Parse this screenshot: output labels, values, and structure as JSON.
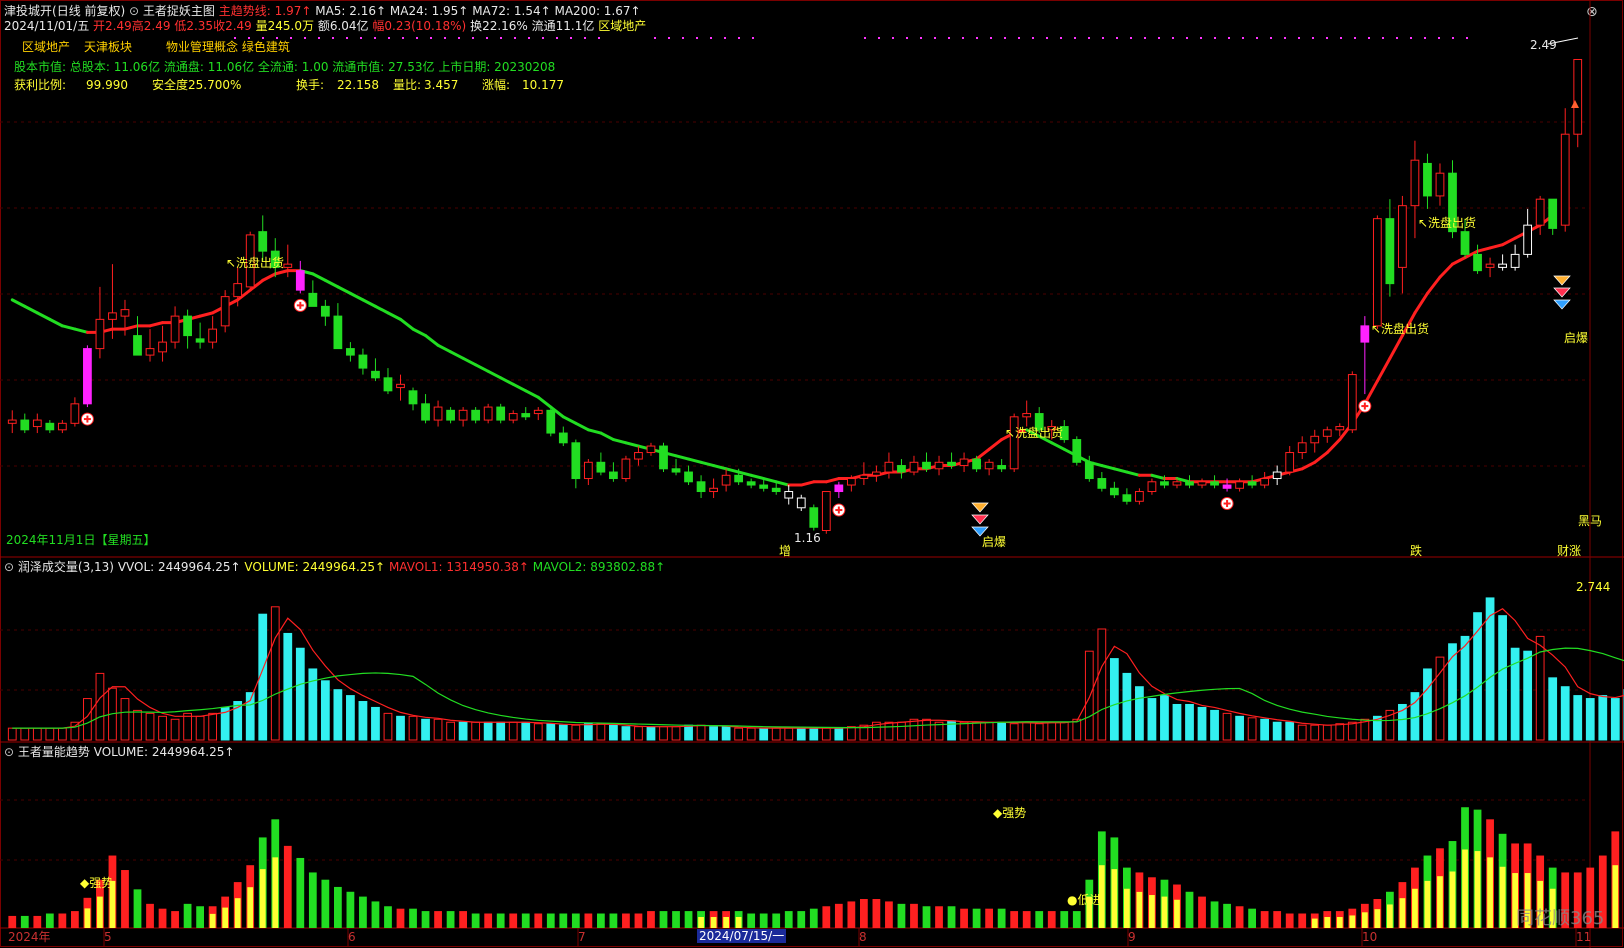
{
  "header": {
    "stock_name": "津投城开",
    "mode": "(日线 前复权)",
    "indicator_toggle": "⊙",
    "indicator_name": "王者捉妖主图",
    "main_trend_label": "主趋势线: 1.97↑",
    "ma5": "MA5: 2.16↑",
    "ma24": "MA24: 1.95↑",
    "ma72": "MA72: 1.54↑",
    "ma200": "MA200: 1.67↑",
    "close_button": "⊗",
    "quote_date": "2024/11/01/五",
    "open": "开2.49",
    "high": "高2.49",
    "low": "低2.35",
    "close": "收2.49",
    "volume": "量245.0万",
    "amount": "额6.04亿",
    "change": "幅0.23(10.18%)",
    "turnover": "换22.16%",
    "float": "流通11.1亿",
    "sector": "区域地产"
  },
  "info": {
    "sector1": "区域地产",
    "sector2": "天津板块",
    "concepts": "物业管理概念 绿色建筑",
    "shares_line": "股本市值: 总股本: 11.06亿 流通盘: 11.06亿 全流通: 1.00 流通市值: 27.53亿 上市日期: 20230208",
    "profit_label": "获利比例:",
    "profit_value": "99.990",
    "safety_label": "安全度25.700%",
    "turnover_label": "换手:",
    "turnover_value": "22.158",
    "vol_ratio_label": "量比:",
    "vol_ratio_value": "3.457",
    "amp_label": "涨幅:",
    "amp_value": "10.177"
  },
  "price_labels": {
    "high_mark": "2.49",
    "low_mark": "1.16",
    "bottom_date": "2024年11月1日【星期五】",
    "black_horse": "黑马"
  },
  "annotations": {
    "wash1": "↖洗盘出货",
    "wash2": "↖洗盘出货",
    "wash3": "↖洗盘出货",
    "wash4": "↖洗盘出货",
    "qibao1": "启爆",
    "qibao2": "启爆",
    "tag_zeng": "增",
    "tag_die": "跌",
    "tag_caizhang": "财涨"
  },
  "volume_pane": {
    "title": "润泽成交量(3,13)",
    "vvol": "VVOL: 2449964.25↑",
    "volume": "VOLUME: 2449964.25↑",
    "mavol1": "MAVOL1: 1314950.38↑",
    "mavol2": "MAVOL2: 893802.88↑",
    "max_label": "2.744"
  },
  "energy_pane": {
    "title": "王者量能趋势",
    "volume": "VOLUME: 2449964.25↑",
    "strong1": "◆强势",
    "strong2": "◆强势",
    "low_in": "●低进"
  },
  "x_axis": {
    "labels": [
      "2024年",
      "5",
      "6",
      "7",
      "8",
      "9",
      "10",
      "11"
    ],
    "cursor_date": "2024/07/15/一"
  },
  "watermark": "同花顺365",
  "colors": {
    "up": "#ff2020",
    "down": "#22dd22",
    "magenta": "#ff22ff",
    "cyan": "#33f0f0",
    "yellow": "#ffff33",
    "grid": "#5a0000",
    "ma_up": "#ff2020",
    "ma_down": "#22dd22"
  },
  "chart_data": {
    "type": "candlestick",
    "x_range": [
      "2024-04",
      "2024-11-01"
    ],
    "candles": [
      {
        "o": 1.37,
        "h": 1.41,
        "l": 1.34,
        "c": 1.38
      },
      {
        "o": 1.38,
        "h": 1.4,
        "l": 1.34,
        "c": 1.35
      },
      {
        "o": 1.36,
        "h": 1.4,
        "l": 1.34,
        "c": 1.38
      },
      {
        "o": 1.37,
        "h": 1.38,
        "l": 1.34,
        "c": 1.35
      },
      {
        "o": 1.35,
        "h": 1.38,
        "l": 1.34,
        "c": 1.37
      },
      {
        "o": 1.37,
        "h": 1.45,
        "l": 1.36,
        "c": 1.43
      },
      {
        "o": 1.43,
        "h": 1.61,
        "l": 1.42,
        "c": 1.6
      },
      {
        "o": 1.6,
        "h": 1.79,
        "l": 1.57,
        "c": 1.69
      },
      {
        "o": 1.69,
        "h": 1.86,
        "l": 1.63,
        "c": 1.71
      },
      {
        "o": 1.7,
        "h": 1.75,
        "l": 1.64,
        "c": 1.72
      },
      {
        "o": 1.64,
        "h": 1.7,
        "l": 1.58,
        "c": 1.58
      },
      {
        "o": 1.58,
        "h": 1.66,
        "l": 1.56,
        "c": 1.6
      },
      {
        "o": 1.59,
        "h": 1.67,
        "l": 1.56,
        "c": 1.62
      },
      {
        "o": 1.62,
        "h": 1.73,
        "l": 1.6,
        "c": 1.7
      },
      {
        "o": 1.7,
        "h": 1.72,
        "l": 1.6,
        "c": 1.64
      },
      {
        "o": 1.63,
        "h": 1.68,
        "l": 1.6,
        "c": 1.62
      },
      {
        "o": 1.62,
        "h": 1.7,
        "l": 1.6,
        "c": 1.66
      },
      {
        "o": 1.67,
        "h": 1.78,
        "l": 1.65,
        "c": 1.76
      },
      {
        "o": 1.76,
        "h": 1.85,
        "l": 1.73,
        "c": 1.8
      },
      {
        "o": 1.79,
        "h": 1.96,
        "l": 1.78,
        "c": 1.95
      },
      {
        "o": 1.96,
        "h": 2.01,
        "l": 1.87,
        "c": 1.9
      },
      {
        "o": 1.9,
        "h": 1.94,
        "l": 1.82,
        "c": 1.85
      },
      {
        "o": 1.85,
        "h": 1.92,
        "l": 1.82,
        "c": 1.86
      },
      {
        "o": 1.84,
        "h": 1.87,
        "l": 1.77,
        "c": 1.78
      },
      {
        "o": 1.77,
        "h": 1.81,
        "l": 1.73,
        "c": 1.73
      },
      {
        "o": 1.73,
        "h": 1.75,
        "l": 1.67,
        "c": 1.7
      },
      {
        "o": 1.7,
        "h": 1.74,
        "l": 1.6,
        "c": 1.6
      },
      {
        "o": 1.6,
        "h": 1.62,
        "l": 1.56,
        "c": 1.58
      },
      {
        "o": 1.58,
        "h": 1.6,
        "l": 1.52,
        "c": 1.54
      },
      {
        "o": 1.53,
        "h": 1.57,
        "l": 1.5,
        "c": 1.51
      },
      {
        "o": 1.51,
        "h": 1.54,
        "l": 1.46,
        "c": 1.47
      },
      {
        "o": 1.48,
        "h": 1.52,
        "l": 1.44,
        "c": 1.49
      },
      {
        "o": 1.47,
        "h": 1.48,
        "l": 1.41,
        "c": 1.43
      },
      {
        "o": 1.43,
        "h": 1.46,
        "l": 1.37,
        "c": 1.38
      },
      {
        "o": 1.38,
        "h": 1.44,
        "l": 1.36,
        "c": 1.42
      },
      {
        "o": 1.41,
        "h": 1.42,
        "l": 1.37,
        "c": 1.38
      },
      {
        "o": 1.38,
        "h": 1.42,
        "l": 1.36,
        "c": 1.41
      },
      {
        "o": 1.41,
        "h": 1.42,
        "l": 1.37,
        "c": 1.38
      },
      {
        "o": 1.38,
        "h": 1.43,
        "l": 1.37,
        "c": 1.42
      },
      {
        "o": 1.42,
        "h": 1.43,
        "l": 1.37,
        "c": 1.38
      },
      {
        "o": 1.38,
        "h": 1.41,
        "l": 1.37,
        "c": 1.4
      },
      {
        "o": 1.4,
        "h": 1.42,
        "l": 1.38,
        "c": 1.39
      },
      {
        "o": 1.4,
        "h": 1.42,
        "l": 1.38,
        "c": 1.41
      },
      {
        "o": 1.41,
        "h": 1.42,
        "l": 1.33,
        "c": 1.34
      },
      {
        "o": 1.34,
        "h": 1.36,
        "l": 1.3,
        "c": 1.31
      },
      {
        "o": 1.31,
        "h": 1.32,
        "l": 1.17,
        "c": 1.2
      },
      {
        "o": 1.2,
        "h": 1.26,
        "l": 1.18,
        "c": 1.25
      },
      {
        "o": 1.25,
        "h": 1.28,
        "l": 1.21,
        "c": 1.22
      },
      {
        "o": 1.22,
        "h": 1.25,
        "l": 1.19,
        "c": 1.2
      },
      {
        "o": 1.2,
        "h": 1.27,
        "l": 1.19,
        "c": 1.26
      },
      {
        "o": 1.26,
        "h": 1.3,
        "l": 1.24,
        "c": 1.28
      },
      {
        "o": 1.28,
        "h": 1.31,
        "l": 1.27,
        "c": 1.3
      },
      {
        "o": 1.3,
        "h": 1.31,
        "l": 1.22,
        "c": 1.23
      },
      {
        "o": 1.23,
        "h": 1.26,
        "l": 1.21,
        "c": 1.22
      },
      {
        "o": 1.22,
        "h": 1.24,
        "l": 1.18,
        "c": 1.19
      },
      {
        "o": 1.19,
        "h": 1.21,
        "l": 1.14,
        "c": 1.16
      },
      {
        "o": 1.16,
        "h": 1.2,
        "l": 1.14,
        "c": 1.17
      },
      {
        "o": 1.18,
        "h": 1.23,
        "l": 1.16,
        "c": 1.21
      },
      {
        "o": 1.21,
        "h": 1.23,
        "l": 1.18,
        "c": 1.19
      },
      {
        "o": 1.19,
        "h": 1.2,
        "l": 1.17,
        "c": 1.18
      },
      {
        "o": 1.18,
        "h": 1.2,
        "l": 1.16,
        "c": 1.17
      },
      {
        "o": 1.17,
        "h": 1.19,
        "l": 1.15,
        "c": 1.16
      },
      {
        "o": 1.16,
        "h": 1.18,
        "l": 1.12,
        "c": 1.14
      },
      {
        "o": 1.14,
        "h": 1.15,
        "l": 1.1,
        "c": 1.11
      },
      {
        "o": 1.11,
        "h": 1.12,
        "l": 1.04,
        "c": 1.05
      },
      {
        "o": 1.04,
        "h": 1.16,
        "l": 1.03,
        "c": 1.16
      },
      {
        "o": 1.16,
        "h": 1.19,
        "l": 1.14,
        "c": 1.18
      },
      {
        "o": 1.18,
        "h": 1.21,
        "l": 1.16,
        "c": 1.2
      },
      {
        "o": 1.2,
        "h": 1.25,
        "l": 1.18,
        "c": 1.21
      },
      {
        "o": 1.21,
        "h": 1.24,
        "l": 1.19,
        "c": 1.22
      },
      {
        "o": 1.22,
        "h": 1.28,
        "l": 1.2,
        "c": 1.25
      },
      {
        "o": 1.24,
        "h": 1.26,
        "l": 1.2,
        "c": 1.22
      },
      {
        "o": 1.22,
        "h": 1.27,
        "l": 1.21,
        "c": 1.25
      },
      {
        "o": 1.25,
        "h": 1.28,
        "l": 1.22,
        "c": 1.23
      },
      {
        "o": 1.23,
        "h": 1.27,
        "l": 1.21,
        "c": 1.25
      },
      {
        "o": 1.25,
        "h": 1.28,
        "l": 1.23,
        "c": 1.24
      },
      {
        "o": 1.24,
        "h": 1.28,
        "l": 1.22,
        "c": 1.26
      },
      {
        "o": 1.26,
        "h": 1.27,
        "l": 1.22,
        "c": 1.23
      },
      {
        "o": 1.23,
        "h": 1.26,
        "l": 1.21,
        "c": 1.25
      },
      {
        "o": 1.24,
        "h": 1.26,
        "l": 1.22,
        "c": 1.23
      },
      {
        "o": 1.23,
        "h": 1.4,
        "l": 1.22,
        "c": 1.39
      },
      {
        "o": 1.39,
        "h": 1.44,
        "l": 1.36,
        "c": 1.4
      },
      {
        "o": 1.4,
        "h": 1.42,
        "l": 1.34,
        "c": 1.35
      },
      {
        "o": 1.35,
        "h": 1.38,
        "l": 1.32,
        "c": 1.36
      },
      {
        "o": 1.36,
        "h": 1.38,
        "l": 1.31,
        "c": 1.32
      },
      {
        "o": 1.32,
        "h": 1.33,
        "l": 1.24,
        "c": 1.25
      },
      {
        "o": 1.25,
        "h": 1.27,
        "l": 1.19,
        "c": 1.2
      },
      {
        "o": 1.2,
        "h": 1.22,
        "l": 1.16,
        "c": 1.17
      },
      {
        "o": 1.17,
        "h": 1.19,
        "l": 1.14,
        "c": 1.15
      },
      {
        "o": 1.15,
        "h": 1.17,
        "l": 1.12,
        "c": 1.13
      },
      {
        "o": 1.13,
        "h": 1.17,
        "l": 1.12,
        "c": 1.16
      },
      {
        "o": 1.16,
        "h": 1.2,
        "l": 1.15,
        "c": 1.19
      },
      {
        "o": 1.19,
        "h": 1.21,
        "l": 1.17,
        "c": 1.18
      },
      {
        "o": 1.18,
        "h": 1.2,
        "l": 1.17,
        "c": 1.19
      },
      {
        "o": 1.19,
        "h": 1.21,
        "l": 1.17,
        "c": 1.18
      },
      {
        "o": 1.18,
        "h": 1.2,
        "l": 1.17,
        "c": 1.19
      },
      {
        "o": 1.19,
        "h": 1.21,
        "l": 1.17,
        "c": 1.18
      },
      {
        "o": 1.18,
        "h": 1.2,
        "l": 1.16,
        "c": 1.17
      },
      {
        "o": 1.17,
        "h": 1.2,
        "l": 1.16,
        "c": 1.19
      },
      {
        "o": 1.19,
        "h": 1.21,
        "l": 1.17,
        "c": 1.18
      },
      {
        "o": 1.18,
        "h": 1.22,
        "l": 1.17,
        "c": 1.2
      },
      {
        "o": 1.2,
        "h": 1.24,
        "l": 1.18,
        "c": 1.22
      },
      {
        "o": 1.22,
        "h": 1.3,
        "l": 1.21,
        "c": 1.28
      },
      {
        "o": 1.28,
        "h": 1.33,
        "l": 1.26,
        "c": 1.31
      },
      {
        "o": 1.31,
        "h": 1.35,
        "l": 1.28,
        "c": 1.33
      },
      {
        "o": 1.33,
        "h": 1.36,
        "l": 1.31,
        "c": 1.35
      },
      {
        "o": 1.35,
        "h": 1.37,
        "l": 1.33,
        "c": 1.36
      },
      {
        "o": 1.35,
        "h": 1.53,
        "l": 1.34,
        "c": 1.52
      },
      {
        "o": 1.62,
        "h": 1.7,
        "l": 1.46,
        "c": 1.67
      },
      {
        "o": 1.67,
        "h": 2.01,
        "l": 1.66,
        "c": 2.0
      },
      {
        "o": 2.0,
        "h": 2.06,
        "l": 1.76,
        "c": 1.8
      },
      {
        "o": 1.85,
        "h": 2.07,
        "l": 1.77,
        "c": 2.04
      },
      {
        "o": 2.04,
        "h": 2.24,
        "l": 1.94,
        "c": 2.18
      },
      {
        "o": 2.17,
        "h": 2.2,
        "l": 2.03,
        "c": 2.07
      },
      {
        "o": 2.07,
        "h": 2.17,
        "l": 2.04,
        "c": 2.14
      },
      {
        "o": 2.14,
        "h": 2.18,
        "l": 1.94,
        "c": 1.96
      },
      {
        "o": 1.96,
        "h": 2.0,
        "l": 1.88,
        "c": 1.89
      },
      {
        "o": 1.89,
        "h": 1.92,
        "l": 1.83,
        "c": 1.84
      },
      {
        "o": 1.85,
        "h": 1.88,
        "l": 1.82,
        "c": 1.86
      },
      {
        "o": 1.86,
        "h": 1.89,
        "l": 1.84,
        "c": 1.85
      },
      {
        "o": 1.85,
        "h": 1.92,
        "l": 1.84,
        "c": 1.89
      },
      {
        "o": 1.89,
        "h": 2.03,
        "l": 1.88,
        "c": 1.98
      },
      {
        "o": 1.98,
        "h": 2.07,
        "l": 1.95,
        "c": 2.06
      },
      {
        "o": 2.06,
        "h": 2.06,
        "l": 1.95,
        "c": 1.97
      },
      {
        "o": 1.98,
        "h": 2.34,
        "l": 1.96,
        "c": 2.26
      },
      {
        "o": 2.26,
        "h": 2.49,
        "l": 2.22,
        "c": 2.49
      }
    ],
    "magenta_bars": [
      6,
      23,
      66,
      97,
      108
    ],
    "white_bars": [
      62,
      63,
      101,
      119,
      120,
      121
    ],
    "main_trend_line": [
      1.75,
      1.73,
      1.71,
      1.69,
      1.67,
      1.66,
      1.65,
      1.65,
      1.66,
      1.66,
      1.67,
      1.67,
      1.68,
      1.68,
      1.69,
      1.7,
      1.71,
      1.73,
      1.75,
      1.78,
      1.81,
      1.83,
      1.84,
      1.84,
      1.83,
      1.81,
      1.79,
      1.77,
      1.75,
      1.73,
      1.71,
      1.69,
      1.66,
      1.64,
      1.61,
      1.59,
      1.57,
      1.55,
      1.53,
      1.51,
      1.49,
      1.47,
      1.45,
      1.42,
      1.39,
      1.37,
      1.35,
      1.34,
      1.32,
      1.31,
      1.3,
      1.29,
      1.28,
      1.27,
      1.26,
      1.25,
      1.24,
      1.23,
      1.22,
      1.21,
      1.2,
      1.19,
      1.18,
      1.18,
      1.19,
      1.19,
      1.2,
      1.2,
      1.21,
      1.21,
      1.22,
      1.22,
      1.23,
      1.23,
      1.24,
      1.24,
      1.25,
      1.26,
      1.29,
      1.32,
      1.34,
      1.35,
      1.33,
      1.31,
      1.29,
      1.27,
      1.25,
      1.24,
      1.23,
      1.22,
      1.21,
      1.21,
      1.2,
      1.2,
      1.19,
      1.19,
      1.19,
      1.19,
      1.19,
      1.19,
      1.2,
      1.21,
      1.22,
      1.23,
      1.25,
      1.28,
      1.32,
      1.37,
      1.43,
      1.5,
      1.57,
      1.64,
      1.71,
      1.77,
      1.82,
      1.86,
      1.88,
      1.9,
      1.91,
      1.92,
      1.94,
      1.96,
      1.98,
      2.01
    ],
    "y_range": [
      0.98,
      2.55
    ]
  },
  "volume_data": {
    "bars": [
      8,
      8,
      8,
      8,
      8,
      12,
      28,
      45,
      35,
      28,
      20,
      18,
      16,
      14,
      18,
      16,
      18,
      22,
      26,
      32,
      85,
      90,
      72,
      62,
      48,
      40,
      34,
      30,
      26,
      22,
      18,
      16,
      16,
      14,
      14,
      12,
      12,
      12,
      12,
      12,
      12,
      12,
      11,
      11,
      10,
      10,
      11,
      11,
      10,
      9,
      9,
      9,
      9,
      9,
      10,
      10,
      9,
      9,
      8,
      8,
      8,
      8,
      8,
      8,
      8,
      8,
      8,
      9,
      10,
      12,
      12,
      12,
      14,
      14,
      12,
      13,
      12,
      12,
      12,
      12,
      11,
      12,
      11,
      12,
      12,
      14,
      60,
      75,
      55,
      45,
      36,
      28,
      30,
      24,
      24,
      22,
      20,
      18,
      16,
      15,
      14,
      12,
      12,
      10,
      10,
      10,
      11,
      12,
      14,
      16,
      20,
      24,
      32,
      48,
      56,
      65,
      70,
      86,
      96,
      84,
      62,
      60,
      70,
      42,
      36,
      30,
      28,
      30,
      28,
      34,
      40,
      100
    ],
    "cyan_bars": [
      17,
      18,
      19,
      20,
      22,
      23,
      24,
      25,
      26,
      27,
      28,
      29,
      31,
      33,
      36,
      38,
      39,
      41,
      43,
      44,
      46,
      48,
      49,
      51,
      54,
      56,
      57,
      60,
      63,
      64,
      66,
      75,
      79,
      88,
      89,
      90,
      91,
      92,
      93,
      94,
      95,
      96,
      98,
      100,
      101,
      102,
      109,
      111,
      112,
      113,
      115,
      116,
      117,
      118,
      119,
      120,
      121,
      123,
      124,
      125,
      126,
      127,
      128,
      129
    ],
    "max_value": 2.744
  },
  "energy_data": {
    "bars": [
      10,
      10,
      10,
      12,
      12,
      14,
      25,
      40,
      60,
      48,
      32,
      20,
      16,
      14,
      20,
      18,
      18,
      26,
      38,
      52,
      75,
      90,
      68,
      58,
      46,
      40,
      34,
      30,
      26,
      22,
      18,
      16,
      16,
      14,
      14,
      14,
      14,
      12,
      12,
      12,
      12,
      12,
      12,
      12,
      12,
      12,
      12,
      12,
      12,
      12,
      12,
      14,
      14,
      14,
      14,
      14,
      14,
      14,
      14,
      12,
      12,
      12,
      14,
      14,
      16,
      18,
      20,
      22,
      24,
      24,
      22,
      20,
      20,
      18,
      18,
      18,
      16,
      16,
      16,
      16,
      14,
      14,
      14,
      14,
      14,
      14,
      40,
      80,
      75,
      50,
      46,
      42,
      40,
      36,
      30,
      26,
      22,
      20,
      18,
      16,
      14,
      14,
      12,
      12,
      12,
      14,
      14,
      16,
      20,
      24,
      30,
      38,
      50,
      60,
      66,
      72,
      100,
      98,
      90,
      78,
      70,
      70,
      60,
      50,
      46,
      46,
      50,
      60,
      80,
      130
    ],
    "yellow_bars": [
      6,
      7,
      8,
      16,
      17,
      18,
      19,
      20,
      21,
      55,
      56,
      57,
      58,
      86,
      87,
      88,
      89,
      90,
      91,
      92,
      93,
      104,
      105,
      106,
      107,
      108,
      109,
      110,
      111,
      112,
      113,
      114,
      115,
      116,
      117,
      118,
      119,
      120,
      121,
      122,
      123,
      128,
      129
    ]
  }
}
